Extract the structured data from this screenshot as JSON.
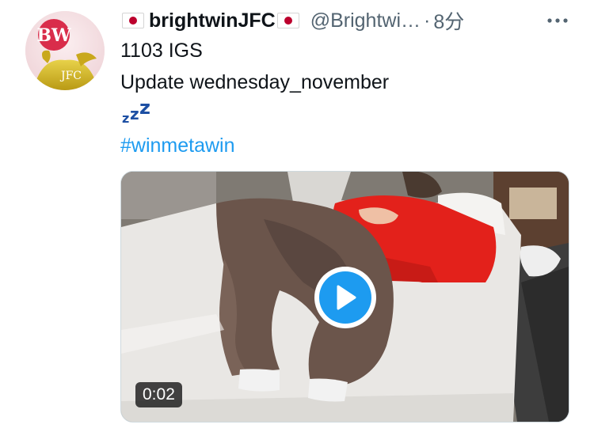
{
  "tweet": {
    "author": {
      "display_name": "brightwinJFC",
      "flag_icon": "japan-flag-icon",
      "handle": "@Brightwi…",
      "time_separator": "·",
      "time": "8分",
      "avatar_text_top": "BW",
      "avatar_text_bottom": "JFC"
    },
    "text": {
      "line1": "1103 IGS",
      "line2": " Update wednesday_november",
      "emoji": "💤",
      "hashtag": "#winmetawin"
    },
    "media": {
      "type": "video",
      "duration": "0:02",
      "play_icon": "play-icon"
    },
    "more_icon": "more-options-icon"
  },
  "colors": {
    "link": "#1d9bf0",
    "muted": "#536471",
    "play_button": "#1d9bf0"
  }
}
